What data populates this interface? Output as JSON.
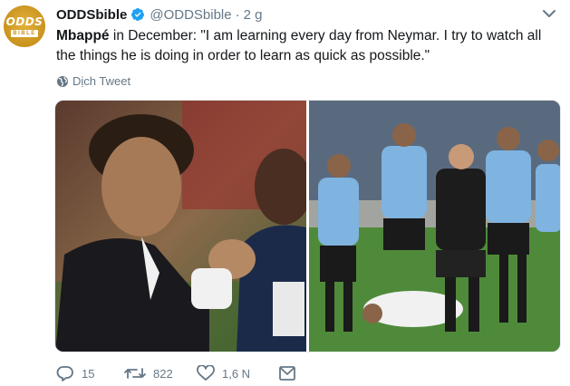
{
  "account": {
    "avatar_text_top": "ODDS",
    "avatar_text_bottom": "BIBLE",
    "display_name": "ODDSbible",
    "handle": "@ODDSbible",
    "separator": "·",
    "time": "2 g",
    "verified_icon": "verified-badge-icon"
  },
  "tweet": {
    "mention": "Mbappé",
    "text": " in December: \"I am learning every day from Neymar. I try to watch all the things he is doing in order to learn as quick as possible.\"",
    "translate_label": "Dịch Tweet"
  },
  "media": {
    "left_photo": "neymar-mbappe-photo",
    "right_photo": "uruguay-players-photo"
  },
  "actions": {
    "reply_count": "15",
    "retweet_count": "822",
    "like_count": "1,6 N"
  },
  "colors": {
    "text": "#14171a",
    "muted": "#657786",
    "verified": "#1da1f2",
    "avatar_gold": "#c9931d"
  }
}
